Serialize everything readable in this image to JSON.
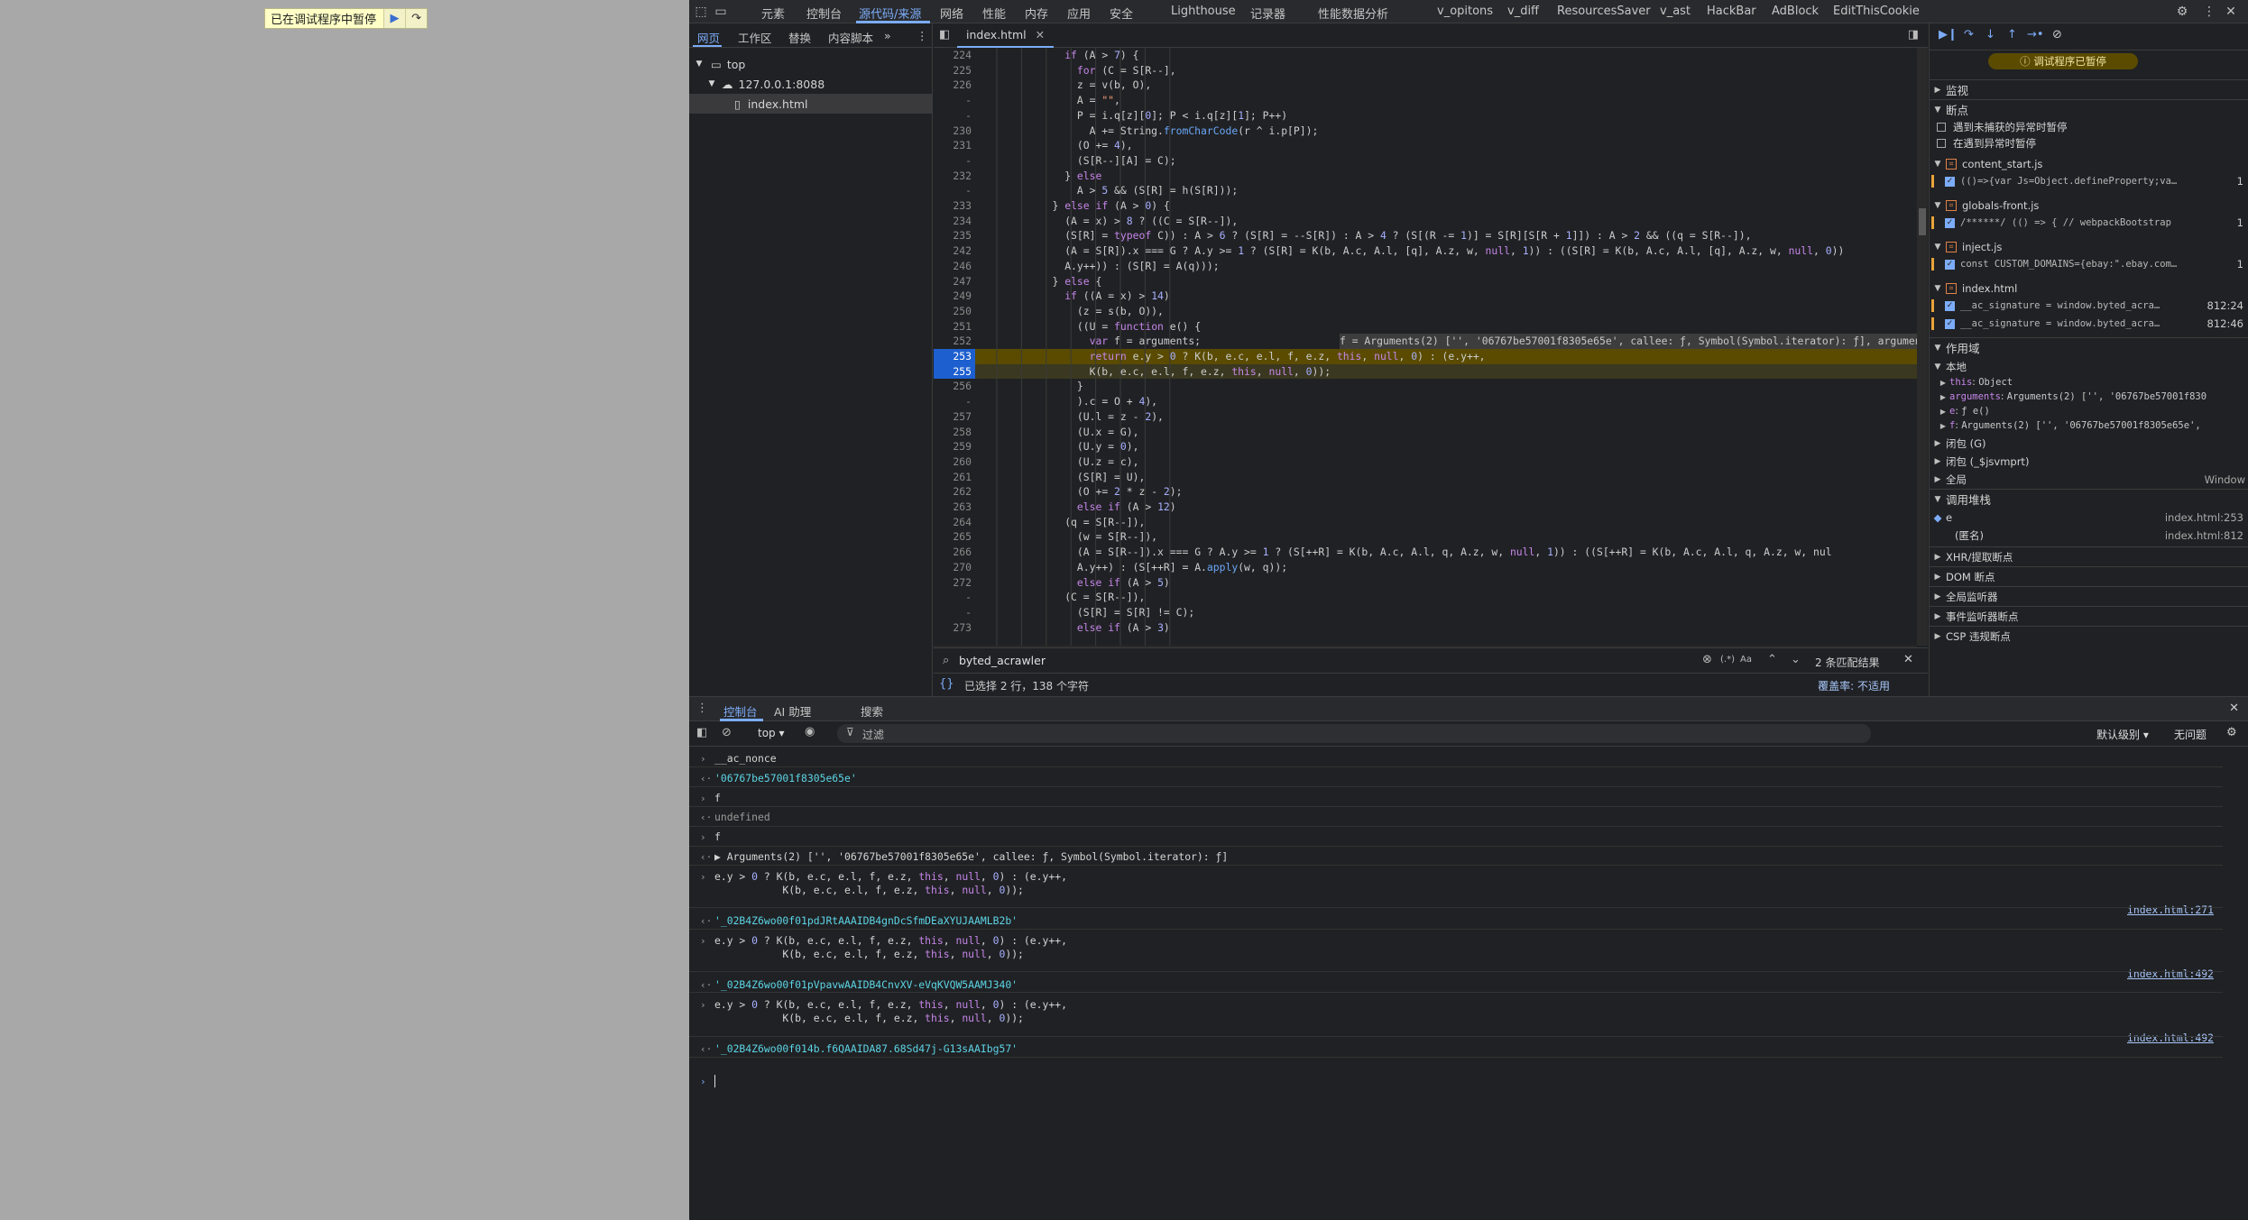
{
  "viewport": {
    "paused_text": "已在调试程序中暂停"
  },
  "topbar": {
    "tabs": [
      "元素",
      "控制台",
      "源代码/来源",
      "网络",
      "性能",
      "内存",
      "应用",
      "安全",
      "Lighthouse",
      "记录器",
      "性能数据分析",
      "v_opitons",
      "v_diff",
      "ResourcesSaver",
      "v_ast",
      "HackBar",
      "AdBlock",
      "EditThisCookie"
    ],
    "active_tab": "源代码/来源"
  },
  "navigator": {
    "tabs": [
      "网页",
      "工作区",
      "替换",
      "内容脚本"
    ],
    "tree": {
      "top": "top",
      "origin": "127.0.0.1:8088",
      "file": "index.html"
    }
  },
  "editor": {
    "file_tab": "index.html",
    "lines": [
      {
        "n": "224",
        "code": "if (A > 7) {"
      },
      {
        "n": "225",
        "code": "for (C = S[R--],"
      },
      {
        "n": "226",
        "code": "z = v(b, O),"
      },
      {
        "n": "-",
        "code": "A = \"\","
      },
      {
        "n": "-",
        "code": "P = i.q[z][0]; P < i.q[z][1]; P++)"
      },
      {
        "n": "230",
        "code": "A += String.fromCharCode(r ^ i.p[P]);"
      },
      {
        "n": "231",
        "code": "(O += 4),"
      },
      {
        "n": "-",
        "code": "(S[R--][A] = C);"
      },
      {
        "n": "232",
        "code": "} else"
      },
      {
        "n": "-",
        "code": "A > 5 && (S[R] = h(S[R]));"
      },
      {
        "n": "233",
        "code": "} else if (A > 0) {"
      },
      {
        "n": "234",
        "code": "(A = x) > 8 ? ((C = S[R--]),"
      },
      {
        "n": "235",
        "code": "(S[R] = typeof C)) : A > 6 ? (S[R] = --S[R]) : A > 4 ? (S[(R -= 1)] = S[R][S[R + 1]]) : A > 2 && ((q = S[R--]),"
      },
      {
        "n": "242",
        "code": "(A = S[R]).x === G ? A.y >= 1 ? (S[R] = K(b, A.c, A.l, [q], A.z, w, null, 1)) : ((S[R] = K(b, A.c, A.l, [q], A.z, w, null, 0))"
      },
      {
        "n": "246",
        "code": "A.y++)) : (S[R] = A(q)));"
      },
      {
        "n": "247",
        "code": "} else {"
      },
      {
        "n": "249",
        "code": "if ((A = x) > 14)"
      },
      {
        "n": "250",
        "code": "(z = s(b, O)),"
      },
      {
        "n": "251",
        "code": "((U = function e() {"
      },
      {
        "n": "252",
        "code": "var f = arguments;",
        "inline": "f = Arguments(2) ['', '06767be57001f8305e65e', callee: ƒ, Symbol(Symbol.iterator): ƒ], arguments ="
      },
      {
        "n": "253",
        "code": "return e.y > 0 ? K(b, e.c, e.l, f, e.z, this, null, 0) : (e.y++,"
      },
      {
        "n": "255",
        "code": "K(b, e.c, e.l, f, e.z, this, null, 0));"
      },
      {
        "n": "256",
        "code": "}"
      },
      {
        "n": "-",
        "code": ").c = O + 4),"
      },
      {
        "n": "257",
        "code": "(U.l = z - 2),"
      },
      {
        "n": "258",
        "code": "(U.x = G),"
      },
      {
        "n": "259",
        "code": "(U.y = 0),"
      },
      {
        "n": "260",
        "code": "(U.z = c),"
      },
      {
        "n": "261",
        "code": "(S[R] = U),"
      },
      {
        "n": "262",
        "code": "(O += 2 * z - 2);"
      },
      {
        "n": "263",
        "code": "else if (A > 12)"
      },
      {
        "n": "264",
        "code": "(q = S[R--]),"
      },
      {
        "n": "265",
        "code": "(w = S[R--]),"
      },
      {
        "n": "266",
        "code": "(A = S[R--]).x === G ? A.y >= 1 ? (S[++R] = K(b, A.c, A.l, q, A.z, w, null, 1)) : ((S[++R] = K(b, A.c, A.l, q, A.z, w, nul"
      },
      {
        "n": "270",
        "code": "A.y++) : (S[++R] = A.apply(w, q));"
      },
      {
        "n": "272",
        "code": "else if (A > 5)"
      },
      {
        "n": "-",
        "code": "(C = S[R--]),"
      },
      {
        "n": "-",
        "code": "(S[R] = S[R] != C);"
      },
      {
        "n": "273",
        "code": "else if (A > 3)"
      }
    ],
    "search": {
      "query": "byted_acrawler",
      "regex": "(.*)",
      "case": "Aa",
      "result": "2 条匹配结果"
    },
    "status": {
      "left": "已选择 2 行，138 个字符",
      "right": "覆盖率: 不适用"
    }
  },
  "sidebar": {
    "paused_badge": "调试程序已暂停",
    "watch": "监视",
    "breakpoints": "断点",
    "pause_uncaught": "遇到未捕获的异常时暂停",
    "pause_caught": "在遇到异常时暂停",
    "bp_files": [
      {
        "file": "content_start.js",
        "snippet": "(()=>{var Js=Object.defineProperty;va…",
        "line": "1"
      },
      {
        "file": "globals-front.js",
        "snippet": "/******/ (() => { // webpackBootstrap",
        "line": "1"
      },
      {
        "file": "inject.js",
        "snippet": "const CUSTOM_DOMAINS={ebay:\".ebay.com…",
        "line": "1"
      },
      {
        "file": "index.html",
        "snippet": "__ac_signature = window.byted_acra…",
        "line": "812:24"
      },
      {
        "file": "",
        "snippet": "__ac_signature = window.byted_acra…",
        "line": "812:46"
      }
    ],
    "scope": "作用域",
    "local": "本地",
    "scope_items": [
      {
        "key": "this",
        "val": "Object"
      },
      {
        "key": "arguments",
        "val": "Arguments(2) ['', '06767be57001f830"
      },
      {
        "key": "e",
        "val": "ƒ e()"
      },
      {
        "key": "f",
        "val": "Arguments(2) ['', '06767be57001f8305e65e',"
      }
    ],
    "closure1": "闭包 (G)",
    "closure2": "闭包 (_$jsvmprt)",
    "global": "全局",
    "global_val": "Window",
    "callstack": "调用堆栈",
    "frames": [
      {
        "name": "e",
        "loc": "index.html:253"
      },
      {
        "name": "(匿名)",
        "loc": "index.html:812"
      }
    ],
    "more": [
      "XHR/提取断点",
      "DOM 断点",
      "全局监听器",
      "事件监听器断点",
      "CSP 违规断点"
    ]
  },
  "drawer": {
    "tabs": [
      "控制台",
      "AI 助理",
      "搜索"
    ],
    "context": "top",
    "filter_placeholder": "过滤",
    "level": "默认级别",
    "issues": "无问题"
  },
  "console": [
    {
      "t": "in",
      "text": "__ac_nonce"
    },
    {
      "t": "out",
      "text": "'06767be57001f8305e65e'"
    },
    {
      "t": "in",
      "text": "f"
    },
    {
      "t": "out",
      "text": "undefined"
    },
    {
      "t": "in",
      "text": "f"
    },
    {
      "t": "out",
      "text": "▶ Arguments(2) ['', '06767be57001f8305e65e', callee: ƒ, Symbol(Symbol.iterator): ƒ]"
    },
    {
      "t": "in",
      "text": "e.y > 0 ? K(b, e.c, e.l, f, e.z, this, null, 0) : (e.y++,",
      "text2": "           K(b, e.c, e.l, f, e.z, this, null, 0));",
      "link": "index.html:271"
    },
    {
      "t": "out",
      "text": "'_02B4Z6wo00f01pdJRtAAAIDB4gnDcSfmDEaXYUJAAMLB2b'"
    },
    {
      "t": "in",
      "text": "e.y > 0 ? K(b, e.c, e.l, f, e.z, this, null, 0) : (e.y++,",
      "text2": "           K(b, e.c, e.l, f, e.z, this, null, 0));",
      "link": "index.html:492"
    },
    {
      "t": "out",
      "text": "'_02B4Z6wo00f01pVpavwAAIDB4CnvXV-eVqKVQW5AAMJ340'"
    },
    {
      "t": "in",
      "text": "e.y > 0 ? K(b, e.c, e.l, f, e.z, this, null, 0) : (e.y++,",
      "text2": "           K(b, e.c, e.l, f, e.z, this, null, 0));",
      "link": "index.html:492"
    },
    {
      "t": "out",
      "text": "'_02B4Z6wo00f014b.f6QAAIDA87.68Sd47j-G13sAAIbg57'"
    }
  ]
}
